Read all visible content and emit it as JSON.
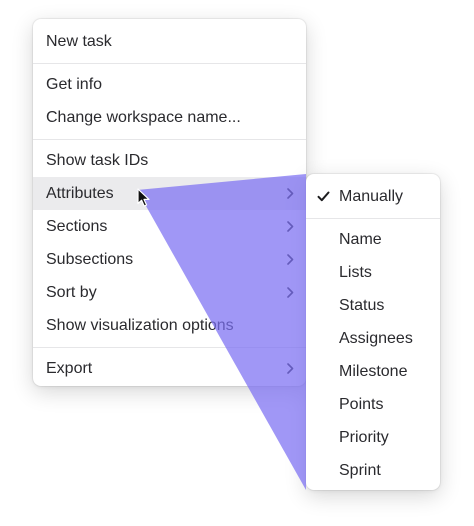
{
  "main_menu": {
    "items": [
      {
        "label": "New task"
      },
      {
        "label": "Get info"
      },
      {
        "label": "Change workspace name..."
      },
      {
        "label": "Show task IDs"
      },
      {
        "label": "Attributes",
        "submenu": true
      },
      {
        "label": "Sections",
        "submenu": true
      },
      {
        "label": "Subsections",
        "submenu": true
      },
      {
        "label": "Sort by",
        "submenu": true
      },
      {
        "label": "Show visualization options"
      },
      {
        "label": "Export",
        "submenu": true
      }
    ]
  },
  "submenu": {
    "checked_label": "Manually",
    "items": [
      "Name",
      "Lists",
      "Status",
      "Assignees",
      "Milestone",
      "Points",
      "Priority",
      "Sprint"
    ]
  },
  "colors": {
    "highlight_bg": "#ebebed",
    "overlay_purple": "#8b7ff5",
    "text": "#2a2a2e"
  },
  "icons": {
    "chevron": "chevron-right-icon",
    "check": "checkmark-icon",
    "cursor": "mouse-pointer-icon"
  }
}
